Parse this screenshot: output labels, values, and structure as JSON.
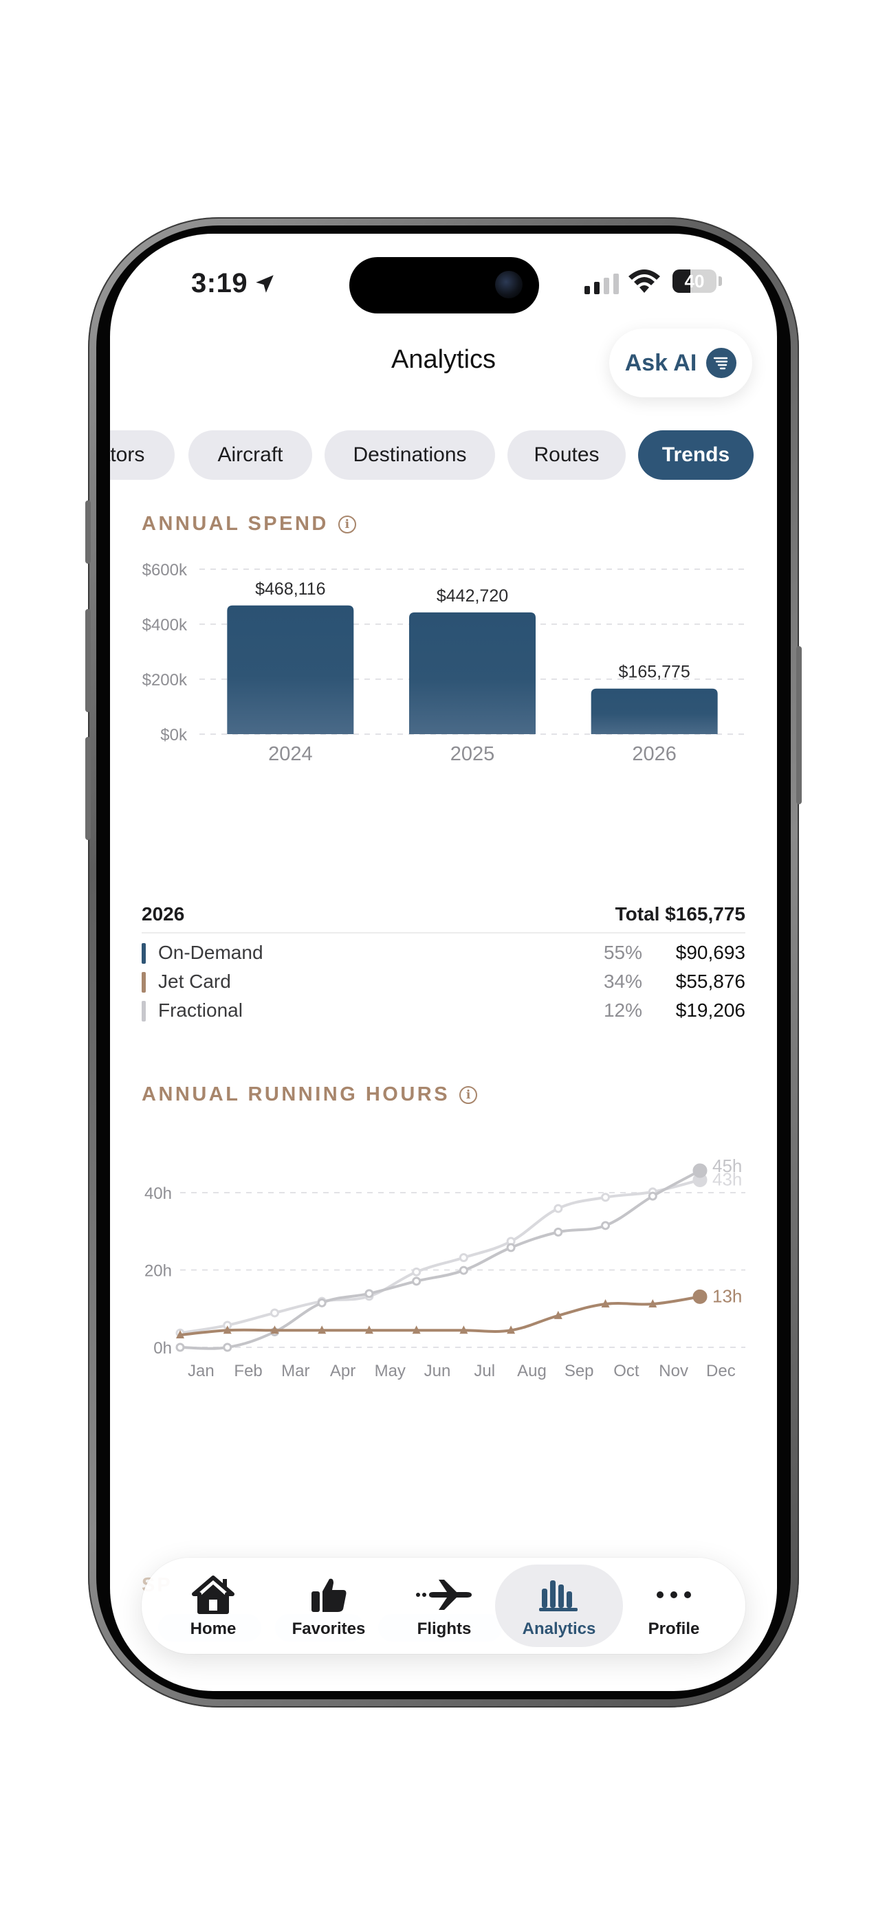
{
  "status_bar": {
    "time": "3:19",
    "battery": "40"
  },
  "header": {
    "title": "Analytics",
    "ask_ai_label": "Ask AI"
  },
  "tabs": [
    {
      "label": "ators",
      "active": false
    },
    {
      "label": "Aircraft",
      "active": false
    },
    {
      "label": "Destinations",
      "active": false
    },
    {
      "label": "Routes",
      "active": false
    },
    {
      "label": "Trends",
      "active": true
    }
  ],
  "annual_spend": {
    "title": "ANNUAL SPEND",
    "breakdown": {
      "year": "2026",
      "total_label": "Total $165,775",
      "rows": [
        {
          "name": "On-Demand",
          "pct": "55%",
          "amount": "$90,693",
          "color": "#2f5575"
        },
        {
          "name": "Jet Card",
          "pct": "34%",
          "amount": "$55,876",
          "color": "#a8866c"
        },
        {
          "name": "Fractional",
          "pct": "12%",
          "amount": "$19,206",
          "color": "#c7c7cc"
        }
      ]
    }
  },
  "annual_running_hours": {
    "title": "ANNUAL RUNNING HOURS"
  },
  "peek_section": {
    "title": "SP"
  },
  "bottom_nav": [
    {
      "label": "Home",
      "icon": "home-icon",
      "active": false
    },
    {
      "label": "Favorites",
      "icon": "thumbs-up-icon",
      "active": false
    },
    {
      "label": "Flights",
      "icon": "airplane-icon",
      "active": false
    },
    {
      "label": "Analytics",
      "icon": "bar-chart-icon",
      "active": true
    },
    {
      "label": "Profile",
      "icon": "more-icon",
      "active": false
    }
  ],
  "chart_data": [
    {
      "type": "bar",
      "categories": [
        "2024",
        "2025",
        "2026"
      ],
      "values": [
        468116,
        442720,
        165775
      ],
      "value_labels": [
        "$468,116",
        "$442,720",
        "$165,775"
      ],
      "ylim": [
        0,
        600000
      ],
      "yticks": [
        0,
        200000,
        400000,
        600000
      ],
      "ytick_labels": [
        "$0k",
        "$200k",
        "$400k",
        "$600k"
      ],
      "grid": true,
      "colors": [
        "#2f5575"
      ]
    },
    {
      "type": "line",
      "categories": [
        "Jan",
        "Feb",
        "Mar",
        "Apr",
        "May",
        "Jun",
        "Jul",
        "Aug",
        "Sep",
        "Oct",
        "Nov",
        "Dec"
      ],
      "ylim": [
        0,
        48
      ],
      "yticks": [
        0,
        20,
        40
      ],
      "ytick_labels": [
        "0h",
        "20h",
        "40h"
      ],
      "grid": true,
      "series": [
        {
          "values": [
            3.7,
            5.7,
            8.9,
            11.9,
            13.2,
            19.5,
            23.2,
            27.4,
            35.9,
            38.8,
            40.2,
            43.3
          ],
          "color": "#d9d9dd",
          "end_label": "43h",
          "marker": "circle"
        },
        {
          "values": [
            0,
            0,
            4,
            11.5,
            13.9,
            17.1,
            19.9,
            25.8,
            29.8,
            31.5,
            39.1,
            45.7
          ],
          "color": "#c4c4c8",
          "end_label": "45h",
          "marker": "circle"
        },
        {
          "values": [
            3.2,
            4.4,
            4.4,
            4.4,
            4.4,
            4.4,
            4.4,
            4.4,
            8.2,
            11.2,
            11.2,
            13.1
          ],
          "color": "#a8866c",
          "end_label": "13h",
          "marker": "triangle"
        }
      ]
    }
  ]
}
